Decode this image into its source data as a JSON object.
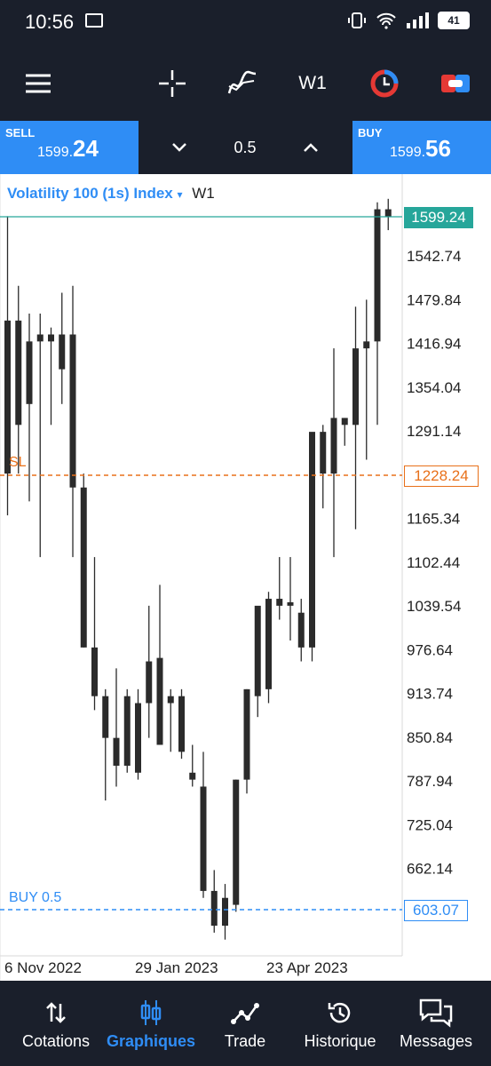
{
  "status_bar": {
    "time": "10:56",
    "battery": "41"
  },
  "toolbar": {
    "timeframe": "W1"
  },
  "trade": {
    "sell_label": "SELL",
    "sell_price_small": "1599.",
    "sell_price_big": "24",
    "lot": "0.5",
    "buy_label": "BUY",
    "buy_price_small": "1599.",
    "buy_price_big": "56"
  },
  "chart": {
    "symbol": "Volatility 100 (1s) Index",
    "symbol_arrow": "▾",
    "timeframe": "W1",
    "price_axis": [
      "1542.74",
      "1479.84",
      "1416.94",
      "1354.04",
      "1291.14",
      "1165.34",
      "1102.44",
      "1039.54",
      "976.64",
      "913.74",
      "850.84",
      "787.94",
      "725.04",
      "662.14"
    ],
    "current_price": "1599.24",
    "sl_label": "SL",
    "sl_price": "1228.24",
    "buy_line_label": "BUY 0.5",
    "buy_line_price": "603.07",
    "date_labels": [
      "6 Nov 2022",
      "29 Jan 2023",
      "23 Apr 2023"
    ],
    "colors": {
      "current": "#26a69a",
      "sl": "#e8701a",
      "buy": "#2f8df5",
      "candle": "#2b2b2b"
    }
  },
  "chart_data": {
    "type": "candlestick",
    "timeframe": "W1",
    "candles": [
      {
        "o": 1450,
        "h": 1600,
        "l": 1170,
        "c": 1230
      },
      {
        "o": 1300,
        "h": 1500,
        "l": 1230,
        "c": 1450
      },
      {
        "o": 1420,
        "h": 1460,
        "l": 1190,
        "c": 1330
      },
      {
        "o": 1430,
        "h": 1460,
        "l": 1110,
        "c": 1420
      },
      {
        "o": 1430,
        "h": 1440,
        "l": 1300,
        "c": 1420
      },
      {
        "o": 1380,
        "h": 1490,
        "l": 1330,
        "c": 1430
      },
      {
        "o": 1430,
        "h": 1500,
        "l": 1110,
        "c": 1210
      },
      {
        "o": 1210,
        "h": 1230,
        "l": 980,
        "c": 980
      },
      {
        "o": 980,
        "h": 1110,
        "l": 890,
        "c": 910
      },
      {
        "o": 910,
        "h": 920,
        "l": 760,
        "c": 850
      },
      {
        "o": 850,
        "h": 950,
        "l": 780,
        "c": 810
      },
      {
        "o": 910,
        "h": 920,
        "l": 800,
        "c": 810
      },
      {
        "o": 800,
        "h": 920,
        "l": 790,
        "c": 900
      },
      {
        "o": 900,
        "h": 1040,
        "l": 850,
        "c": 960
      },
      {
        "o": 965,
        "h": 1070,
        "l": 840,
        "c": 840
      },
      {
        "o": 900,
        "h": 920,
        "l": 830,
        "c": 910
      },
      {
        "o": 910,
        "h": 920,
        "l": 820,
        "c": 830
      },
      {
        "o": 800,
        "h": 840,
        "l": 780,
        "c": 790
      },
      {
        "o": 780,
        "h": 830,
        "l": 620,
        "c": 630
      },
      {
        "o": 630,
        "h": 660,
        "l": 570,
        "c": 580
      },
      {
        "o": 580,
        "h": 640,
        "l": 560,
        "c": 620
      },
      {
        "o": 610,
        "h": 790,
        "l": 600,
        "c": 790
      },
      {
        "o": 790,
        "h": 920,
        "l": 770,
        "c": 920
      },
      {
        "o": 910,
        "h": 1010,
        "l": 880,
        "c": 1040
      },
      {
        "o": 920,
        "h": 1060,
        "l": 900,
        "c": 1050
      },
      {
        "o": 1040,
        "h": 1110,
        "l": 1020,
        "c": 1050
      },
      {
        "o": 1040,
        "h": 1110,
        "l": 990,
        "c": 1045
      },
      {
        "o": 980,
        "h": 1050,
        "l": 960,
        "c": 1030
      },
      {
        "o": 980,
        "h": 1280,
        "l": 960,
        "c": 1290
      },
      {
        "o": 1230,
        "h": 1300,
        "l": 1180,
        "c": 1290
      },
      {
        "o": 1230,
        "h": 1410,
        "l": 1110,
        "c": 1310
      },
      {
        "o": 1300,
        "h": 1310,
        "l": 1270,
        "c": 1310
      },
      {
        "o": 1300,
        "h": 1470,
        "l": 1150,
        "c": 1410
      },
      {
        "o": 1410,
        "h": 1480,
        "l": 1250,
        "c": 1420
      },
      {
        "o": 1420,
        "h": 1620,
        "l": 1300,
        "c": 1610
      },
      {
        "o": 1610,
        "h": 1625,
        "l": 1580,
        "c": 1599
      }
    ],
    "ylim": [
      540,
      1630
    ]
  },
  "bottom_nav": {
    "items": [
      {
        "label": "Cotations",
        "icon": "arrows-updown-icon",
        "active": false
      },
      {
        "label": "Graphiques",
        "icon": "candles-icon",
        "active": true
      },
      {
        "label": "Trade",
        "icon": "trend-icon",
        "active": false
      },
      {
        "label": "Historique",
        "icon": "history-icon",
        "active": false
      },
      {
        "label": "Messages",
        "icon": "chat-icon",
        "active": false
      }
    ]
  }
}
